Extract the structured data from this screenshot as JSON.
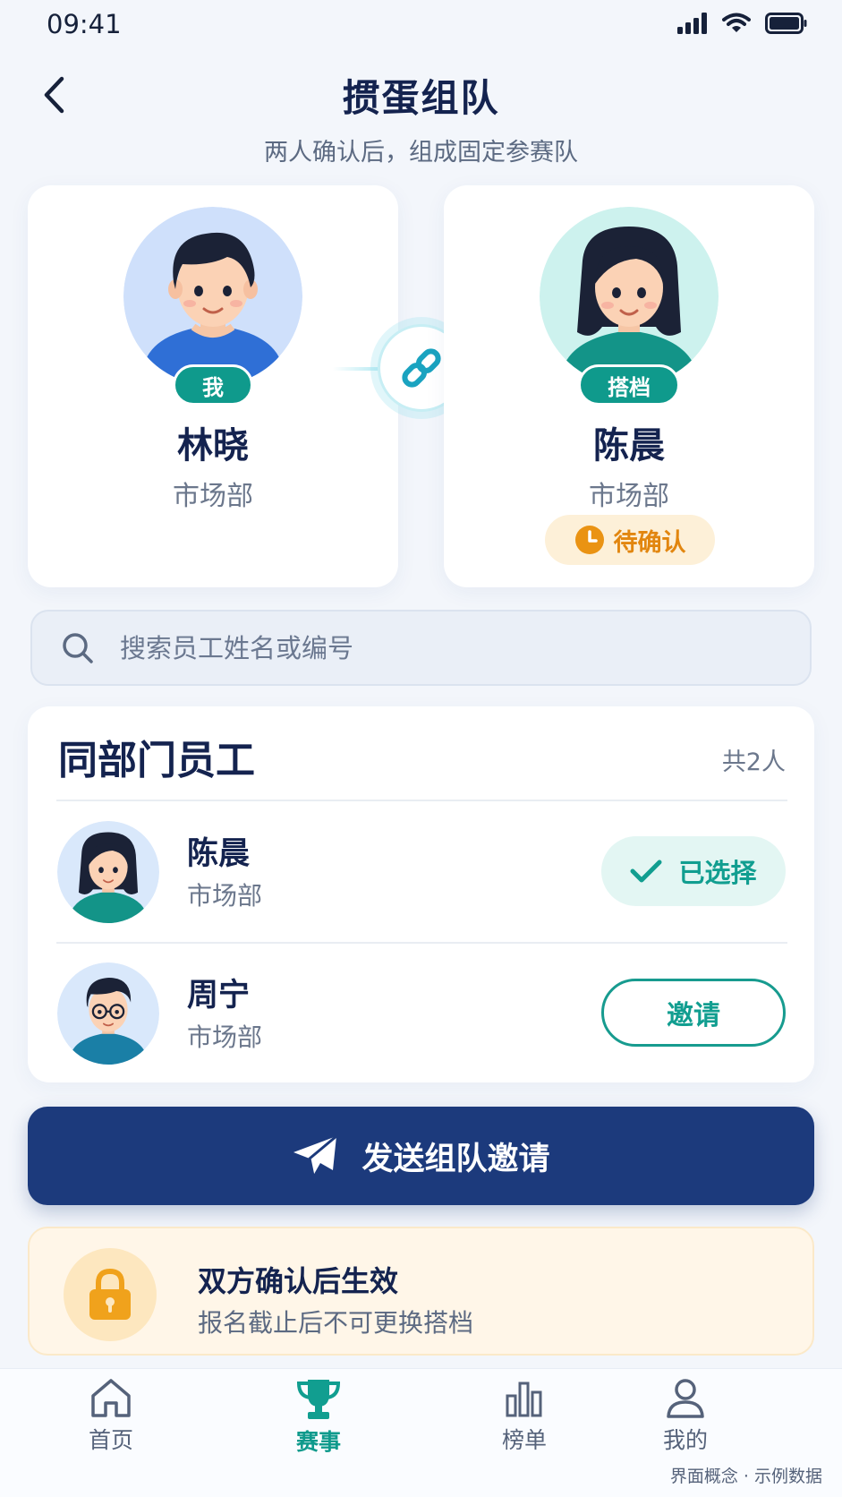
{
  "status_bar": {
    "time": "09:41"
  },
  "header": {
    "title": "掼蛋组队",
    "subtitle": "两人确认后，组成固定参赛队"
  },
  "me": {
    "tag": "我",
    "name": "林晓",
    "dept": "市场部"
  },
  "partner": {
    "tag": "搭档",
    "name": "陈晨",
    "dept": "市场部",
    "status": "待确认"
  },
  "search": {
    "placeholder": "搜索员工姓名或编号"
  },
  "colleagues": {
    "title": "同部门员工",
    "count": "共2人",
    "items": [
      {
        "name": "陈晨",
        "dept": "市场部",
        "action": "已选择"
      },
      {
        "name": "周宁",
        "dept": "市场部",
        "action": "邀请"
      }
    ]
  },
  "send_button": {
    "label": "发送组队邀请"
  },
  "notice": {
    "title": "双方确认后生效",
    "subtitle": "报名截止后不可更换搭档"
  },
  "nav": {
    "items": [
      {
        "label": "首页",
        "icon": "home-icon"
      },
      {
        "label": "赛事",
        "icon": "trophy-icon"
      },
      {
        "label": "榜单",
        "icon": "bar-chart-icon"
      },
      {
        "label": "我的",
        "icon": "user-icon"
      }
    ],
    "active": "赛事"
  },
  "footnote": "界面概念 · 示例数据",
  "colors": {
    "primary": "#1c3a7c",
    "accent": "#0f9a8c",
    "pending": "#e2860f",
    "background": "#f3f6fb"
  }
}
